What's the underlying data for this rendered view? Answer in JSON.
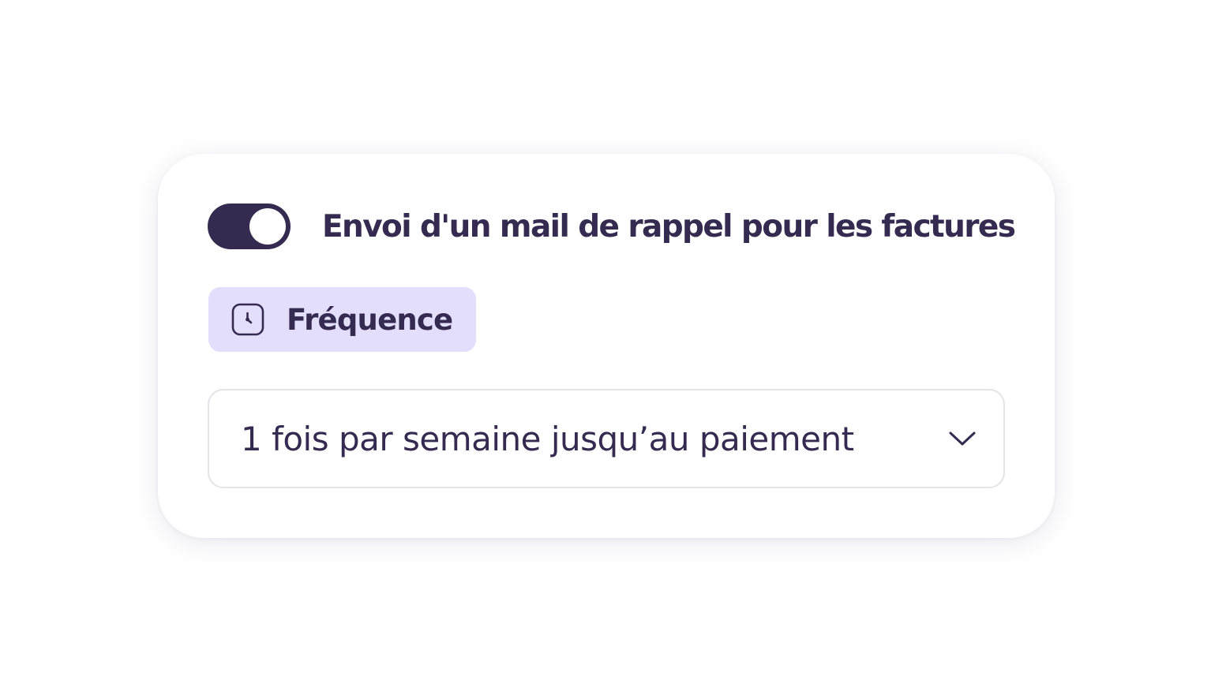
{
  "reminder": {
    "enabled": true,
    "label": "Envoi d'un mail de rappel pour les factures"
  },
  "frequency": {
    "icon": "clock-icon",
    "label": "Fréquence"
  },
  "select": {
    "value": "1 fois par semaine jusqu’au paiement",
    "icon": "chevron-down-icon"
  },
  "colors": {
    "primary": "#352a50",
    "badge_background": "#e2defc",
    "border": "#e5e3ea",
    "background": "#ffffff"
  }
}
